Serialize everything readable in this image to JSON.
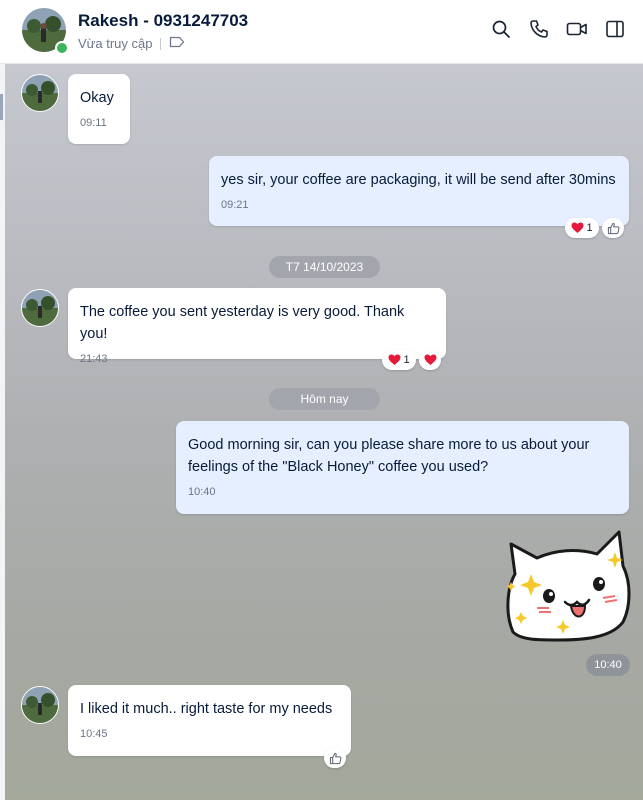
{
  "contact": {
    "name": "Rakesh - 0931247703",
    "status": "Vừa truy cập"
  },
  "header_icons": [
    "search-icon",
    "phone-icon",
    "video-call-icon",
    "sidebar-toggle-icon"
  ],
  "messages": [
    {
      "id": "m1",
      "direction": "incoming",
      "text": "Okay",
      "time": "09:11"
    },
    {
      "id": "m2",
      "direction": "outgoing",
      "text": "yes sir, your coffee are packaging, it will be send after 30mins",
      "time": "09:21",
      "reactions": {
        "heart_count": "1",
        "like": true
      }
    },
    {
      "id": "m3",
      "direction": "incoming",
      "text": "The coffee you sent yesterday is very good. Thank you!",
      "time": "21:43",
      "reactions": {
        "heart_count": "1",
        "heart": true
      }
    },
    {
      "id": "m4",
      "direction": "outgoing",
      "text": "Good morning sir, can you please share more to us about your feelings of the \"Black Honey\" coffee you used?",
      "time": "10:40"
    },
    {
      "id": "m5",
      "direction": "outgoing",
      "type": "sticker",
      "sticker": "white-cat-sparkle-sticker",
      "time": "10:40"
    },
    {
      "id": "m6",
      "direction": "incoming",
      "text": "I liked it much.. right taste for my needs",
      "time": "10:45",
      "reactions": {
        "like": true
      }
    }
  ],
  "date_separators": {
    "first": "T7 14/10/2023",
    "second": "Hôm nay"
  },
  "colors": {
    "header_bg": "#ffffff",
    "incoming_bubble": "#ffffff",
    "outgoing_bubble": "#e5efff",
    "online_dot": "#3cb55a",
    "heart": "#e5193a",
    "text": "#081b3a"
  }
}
